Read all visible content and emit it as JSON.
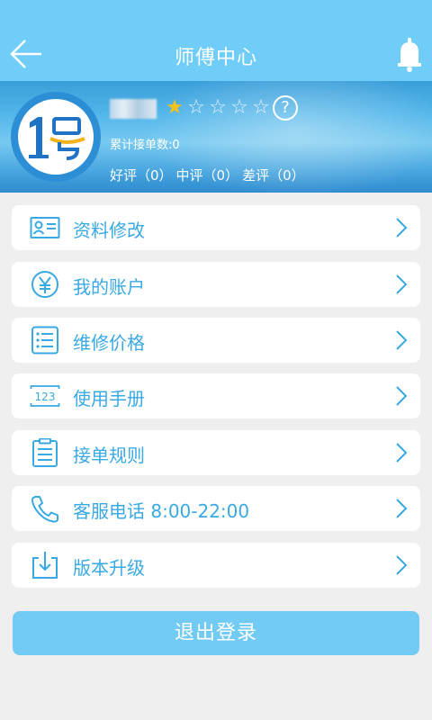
{
  "header": {
    "title": "师傅中心",
    "back_icon": "back-arrow-icon",
    "bell_icon": "bell-icon"
  },
  "profile": {
    "avatar_text": "1号",
    "rating_stars": 1,
    "rating_max": 5,
    "help_label": "?",
    "order_count": "累计接单数:0",
    "ratings": {
      "good": "好评（0）",
      "neutral": "中评（0）",
      "bad": "差评（0）"
    }
  },
  "menu": {
    "items": [
      {
        "label": "资料修改",
        "icon": "id-card-icon"
      },
      {
        "label": "我的账户",
        "icon": "yuan-icon"
      },
      {
        "label": "维修价格",
        "icon": "list-icon"
      },
      {
        "label": "使用手册",
        "icon": "numbers-123-icon"
      },
      {
        "label": "接单规则",
        "icon": "clipboard-icon"
      },
      {
        "label": "客服电话 8:00-22:00",
        "icon": "phone-icon"
      },
      {
        "label": "版本升级",
        "icon": "download-icon"
      }
    ]
  },
  "logout": {
    "label": "退出登录"
  },
  "colors": {
    "header_bg": "#6fcdf8",
    "accent": "#39a9e3",
    "star_on": "#f3c21c",
    "page_bg": "#efefef",
    "logout_bg": "#72cbf5"
  }
}
